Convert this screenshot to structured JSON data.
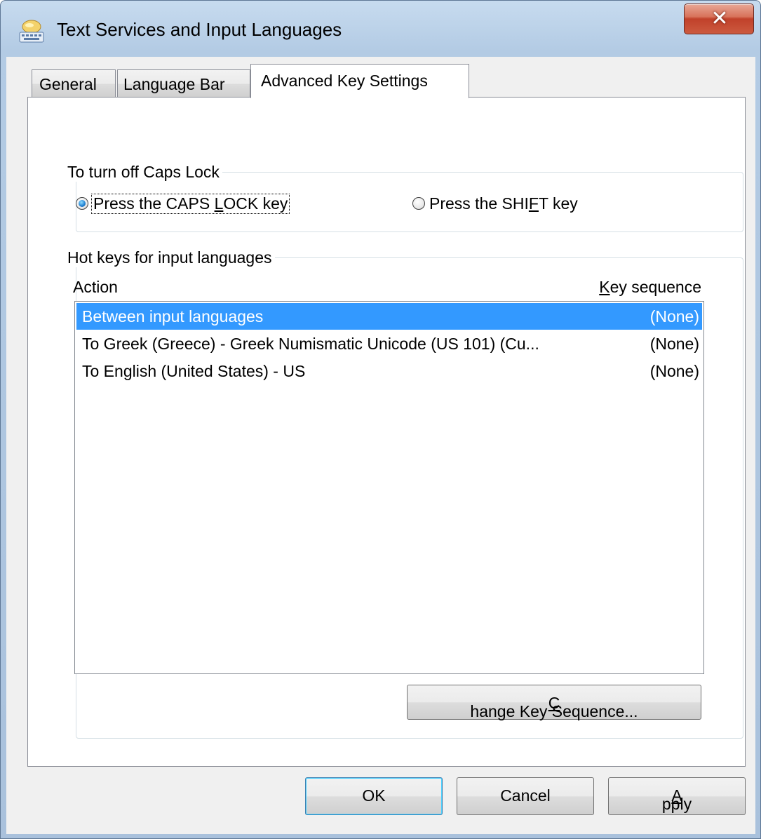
{
  "window": {
    "title": "Text Services and Input Languages",
    "close_glyph": "✕"
  },
  "tabs": [
    {
      "label": "General",
      "active": false
    },
    {
      "label": "Language Bar",
      "active": false
    },
    {
      "label": "Advanced Key Settings",
      "active": true
    }
  ],
  "caps_lock": {
    "group_label": "To turn off Caps Lock",
    "options": [
      {
        "label_pre": "Press the CAPS ",
        "label_mnemonic": "L",
        "label_post": "OCK key",
        "checked": true
      },
      {
        "label_pre": "Press the SHI",
        "label_mnemonic": "F",
        "label_post": "T key",
        "checked": false
      }
    ]
  },
  "hotkeys": {
    "group_label": "Hot keys for input languages",
    "columns": {
      "action": "Action",
      "key_sequence_mnemonic": "K",
      "key_sequence_rest": "ey sequence"
    },
    "rows": [
      {
        "action": "Between input languages",
        "key": "(None)",
        "selected": true
      },
      {
        "action": "To Greek (Greece) - Greek Numismatic Unicode (US 101) (Cu...",
        "key": "(None)",
        "selected": false
      },
      {
        "action": "To English (United States) - US",
        "key": "(None)",
        "selected": false
      }
    ],
    "change_button": {
      "mnemonic": "C",
      "rest": "hange Key Sequence..."
    }
  },
  "footer": {
    "ok_label": "OK",
    "cancel_label": "Cancel",
    "apply_mnemonic": "A",
    "apply_rest": "pply"
  },
  "icons": {
    "app_icon": "keyboard-language-icon",
    "close_icon": "close-icon"
  },
  "colors": {
    "selection": "#3399ff",
    "close_button": "#c1412a",
    "title_bar": "#b3cbe4"
  }
}
